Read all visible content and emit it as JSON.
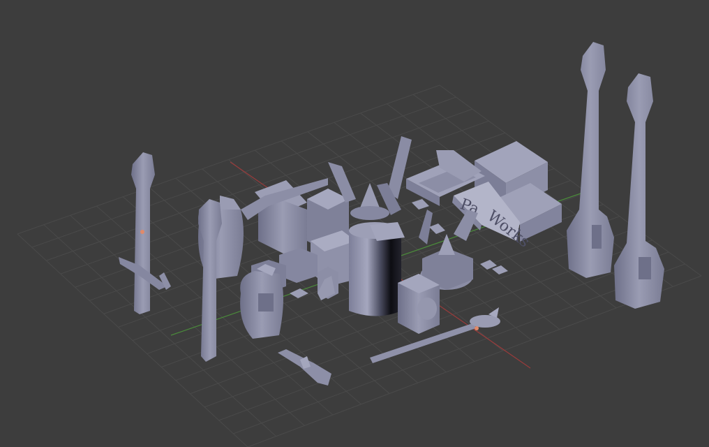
{
  "viewport": {
    "type": "3d-viewport",
    "background": "#3d3d3d",
    "grid_color": "#4a4a4a",
    "x_axis_color": "#9a3b3b",
    "y_axis_color": "#4b8b3b",
    "mesh_color": "#8a8ca6",
    "mesh_shadow_color": "#5c5e76",
    "mesh_highlight_color": "#a7a9c0",
    "cursor_color": "#e08a6a"
  },
  "scene": {
    "engraved_text_1": "Pa",
    "engraved_text_2": "Works",
    "objects": [
      "tower-left",
      "tower-mid-left",
      "tower-right-1",
      "tower-right-2",
      "pod-left",
      "pod-front-left",
      "pod-right-1",
      "pod-right-2",
      "central-cylinder",
      "cone-structure-left",
      "cone-structure-right",
      "block-platform",
      "ramp",
      "signboard",
      "staff-object",
      "small-boat-left",
      "small-boat-front"
    ]
  }
}
